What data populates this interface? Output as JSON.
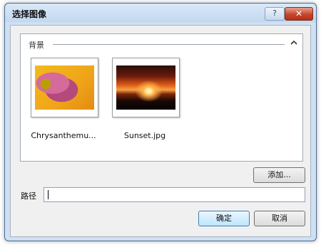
{
  "window": {
    "title": "选择图像"
  },
  "titlebar_buttons": {
    "help_label": "?",
    "close_label": "✕"
  },
  "group": {
    "title": "背景",
    "collapse_icon": "chevron-up-icon"
  },
  "images": [
    {
      "label": "Chrysanthemu..."
    },
    {
      "label": "Sunset.jpg"
    }
  ],
  "buttons": {
    "add_label": "添加...",
    "ok_label": "确定",
    "cancel_label": "取消"
  },
  "path": {
    "label": "路径",
    "value": ""
  }
}
